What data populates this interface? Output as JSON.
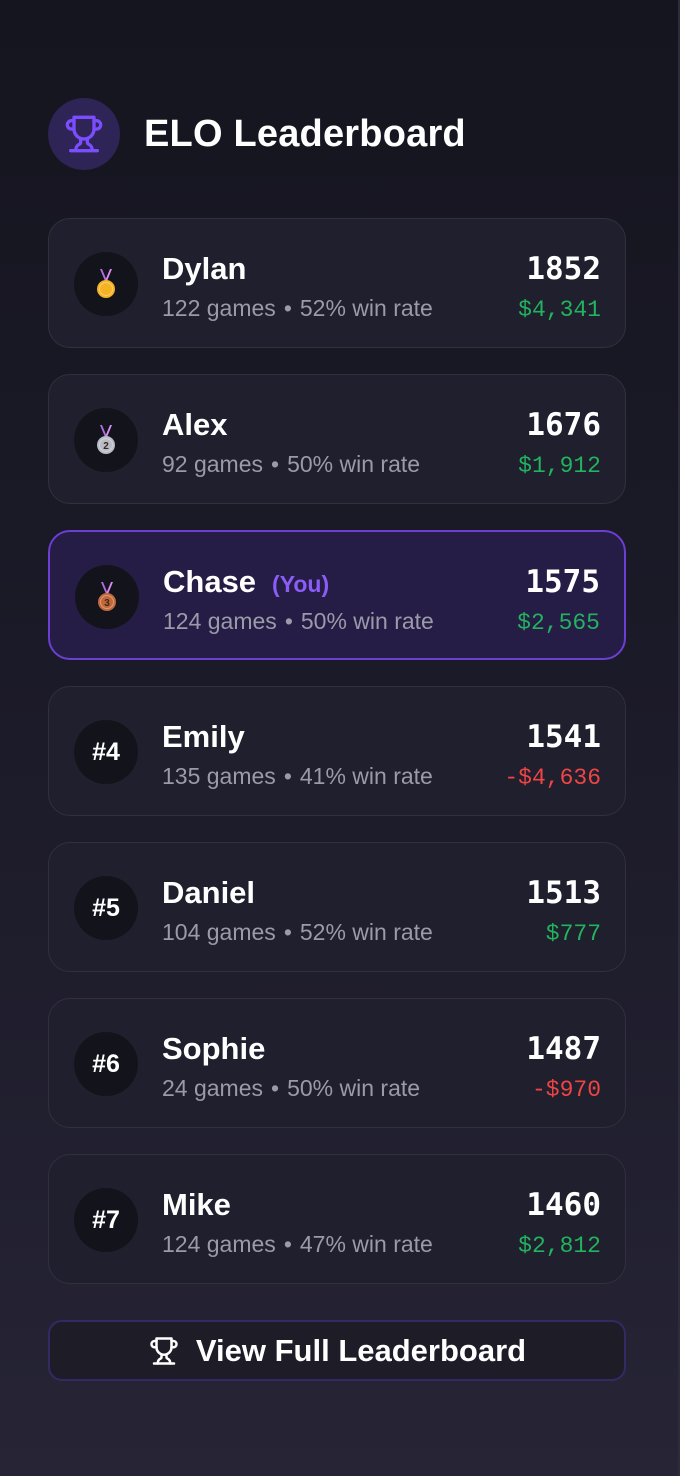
{
  "header": {
    "title": "ELO Leaderboard",
    "icon": "trophy-icon",
    "icon_color": "#7c4dff"
  },
  "players": [
    {
      "rank_badge": "gold-medal-icon",
      "name": "Dylan",
      "you_tag": "",
      "games": "122 games",
      "separator": "•",
      "win_rate": "52% win rate",
      "elo": "1852",
      "earnings": "$4,341",
      "earnings_sign": "positive",
      "is_current_user": false
    },
    {
      "rank_badge": "silver-medal-icon",
      "name": "Alex",
      "you_tag": "",
      "games": "92 games",
      "separator": "•",
      "win_rate": "50% win rate",
      "elo": "1676",
      "earnings": "$1,912",
      "earnings_sign": "positive",
      "is_current_user": false
    },
    {
      "rank_badge": "bronze-medal-icon",
      "name": "Chase",
      "you_tag": "(You)",
      "games": "124 games",
      "separator": "•",
      "win_rate": "50% win rate",
      "elo": "1575",
      "earnings": "$2,565",
      "earnings_sign": "positive",
      "is_current_user": true
    },
    {
      "rank_badge": "#4",
      "name": "Emily",
      "you_tag": "",
      "games": "135 games",
      "separator": "•",
      "win_rate": "41% win rate",
      "elo": "1541",
      "earnings": "-$4,636",
      "earnings_sign": "negative",
      "is_current_user": false
    },
    {
      "rank_badge": "#5",
      "name": "Daniel",
      "you_tag": "",
      "games": "104 games",
      "separator": "•",
      "win_rate": "52% win rate",
      "elo": "1513",
      "earnings": "$777",
      "earnings_sign": "positive",
      "is_current_user": false
    },
    {
      "rank_badge": "#6",
      "name": "Sophie",
      "you_tag": "",
      "games": "24 games",
      "separator": "•",
      "win_rate": "50% win rate",
      "elo": "1487",
      "earnings": "-$970",
      "earnings_sign": "negative",
      "is_current_user": false
    },
    {
      "rank_badge": "#7",
      "name": "Mike",
      "you_tag": "",
      "games": "124 games",
      "separator": "•",
      "win_rate": "47% win rate",
      "elo": "1460",
      "earnings": "$2,812",
      "earnings_sign": "positive",
      "is_current_user": false
    }
  ],
  "footer": {
    "button_label": "View Full Leaderboard",
    "button_icon": "trophy-icon"
  },
  "colors": {
    "accent": "#7c4dff",
    "you_tag": "#8b5cf6",
    "positive": "#22b35e",
    "negative": "#ef4444"
  }
}
